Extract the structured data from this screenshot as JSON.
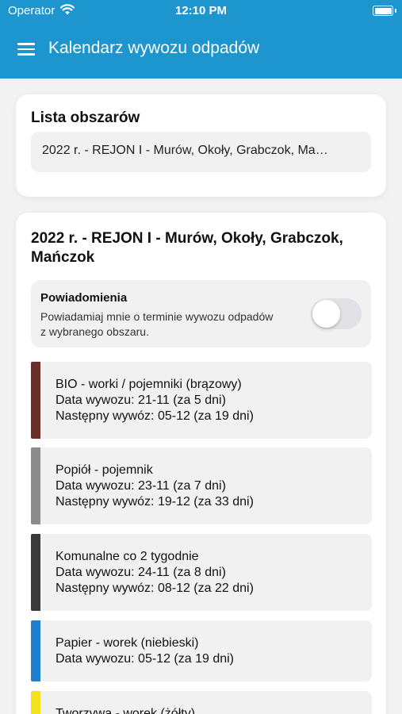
{
  "status_bar": {
    "carrier": "Operator",
    "time": "12:10 PM"
  },
  "app_bar": {
    "title": "Kalendarz wywozu odpadów"
  },
  "area_list": {
    "heading": "Lista obszarów",
    "selected": "2022 r. - REJON I - Murów, Okoły, Grabczok, Ma…"
  },
  "region": {
    "title": "2022 r. - REJON I - Murów, Okoły, Grabczok, Mańczok",
    "notifications": {
      "title": "Powiadomienia",
      "description": "Powiadamiaj mnie o terminie wywozu odpadów z wybranego obszaru.",
      "enabled": false
    },
    "items": [
      {
        "name": "BIO - worki / pojemniki (brązowy)",
        "date": "Data wywozu: 21-11 (za 5 dni)",
        "next": "Następny wywóz: 05-12 (za 19 dni)",
        "color": "#6b2e28"
      },
      {
        "name": "Popiół - pojemnik",
        "date": "Data wywozu: 23-11 (za 7 dni)",
        "next": "Następny wywóz: 19-12 (za 33 dni)",
        "color": "#8c8c8c"
      },
      {
        "name": "Komunalne co 2 tygodnie",
        "date": "Data wywozu: 24-11 (za 8 dni)",
        "next": "Następny wywóz: 08-12 (za 22 dni)",
        "color": "#3a3a3c"
      },
      {
        "name": "Papier - worek (niebieski)",
        "date": "Data wywozu: 05-12 (za 19 dni)",
        "next": "",
        "color": "#1f7fcf"
      },
      {
        "name": "Tworzywa - worek (żółty)",
        "date": "",
        "next": "",
        "color": "#f4e21a"
      }
    ]
  },
  "colors": {
    "accent": "#1d96cf"
  }
}
